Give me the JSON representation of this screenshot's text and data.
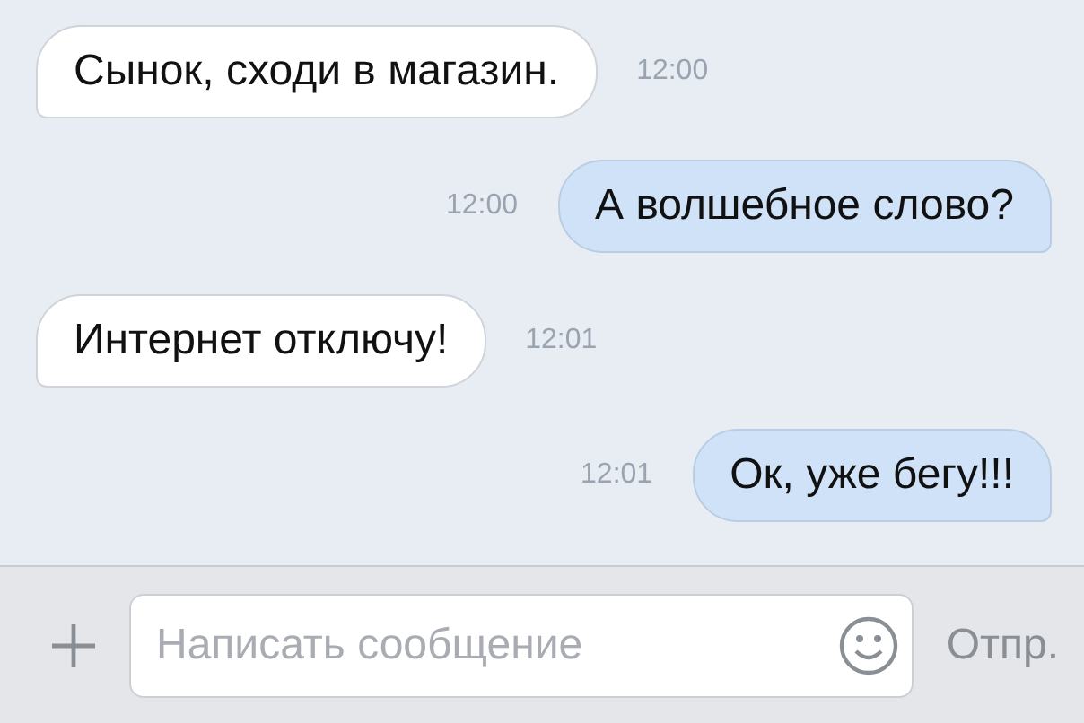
{
  "messages": [
    {
      "text": "Сынок, сходи в магазин.",
      "time": "12:00",
      "outgoing": false
    },
    {
      "text": "А волшебное слово?",
      "time": "12:00",
      "outgoing": true
    },
    {
      "text": "Интернет отключу!",
      "time": "12:01",
      "outgoing": false
    },
    {
      "text": "Ок, уже бегу!!!",
      "time": "12:01",
      "outgoing": true
    }
  ],
  "composer": {
    "placeholder": "Написать сообщение",
    "send": "Отпр."
  }
}
